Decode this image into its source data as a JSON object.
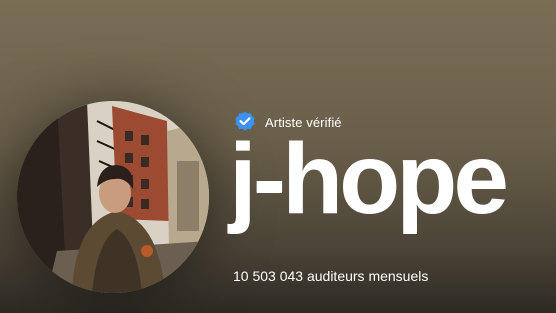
{
  "artist": {
    "verified_label": "Artiste vérifié",
    "name": "j-hope",
    "monthly_listeners": "10 503 043 auditeurs mensuels"
  },
  "icons": {
    "verified": "verified-badge-icon"
  },
  "colors": {
    "background_top": "#7a6e55",
    "background_bottom": "#2e2a24",
    "verified_badge": "#3d91f4",
    "text": "#ffffff"
  }
}
